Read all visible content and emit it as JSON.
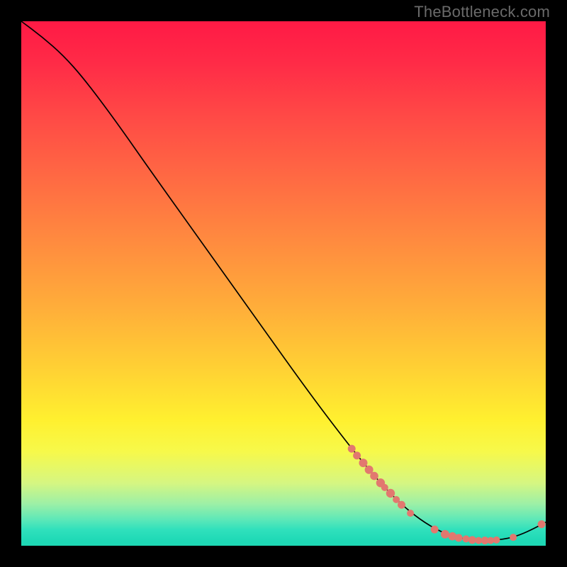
{
  "watermark": "TheBottleneck.com",
  "colors": {
    "marker": "#e2786f",
    "curve": "#000000",
    "frame_bg": "#000000"
  },
  "chart_data": {
    "type": "line",
    "title": "",
    "xlabel": "",
    "ylabel": "",
    "x_range": [
      0,
      100
    ],
    "y_range": [
      0,
      100
    ],
    "curve": [
      {
        "x": 0,
        "y": 100
      },
      {
        "x": 4,
        "y": 97
      },
      {
        "x": 8,
        "y": 93.5
      },
      {
        "x": 12,
        "y": 89
      },
      {
        "x": 18,
        "y": 81
      },
      {
        "x": 25,
        "y": 71
      },
      {
        "x": 35,
        "y": 57
      },
      {
        "x": 45,
        "y": 43
      },
      {
        "x": 55,
        "y": 29
      },
      {
        "x": 63,
        "y": 18.5
      },
      {
        "x": 68,
        "y": 12.5
      },
      {
        "x": 72,
        "y": 8.3
      },
      {
        "x": 76,
        "y": 5.0
      },
      {
        "x": 80,
        "y": 2.6
      },
      {
        "x": 84,
        "y": 1.3
      },
      {
        "x": 88,
        "y": 1.0
      },
      {
        "x": 92,
        "y": 1.2
      },
      {
        "x": 95,
        "y": 2.0
      },
      {
        "x": 98,
        "y": 3.4
      },
      {
        "x": 100,
        "y": 4.5
      }
    ],
    "markers": [
      {
        "x": 63.0,
        "y": 18.5,
        "r": 5.5
      },
      {
        "x": 64.0,
        "y": 17.2,
        "r": 5.5
      },
      {
        "x": 65.2,
        "y": 15.8,
        "r": 6.0
      },
      {
        "x": 66.3,
        "y": 14.5,
        "r": 6.0
      },
      {
        "x": 67.3,
        "y": 13.3,
        "r": 5.8
      },
      {
        "x": 68.5,
        "y": 12.0,
        "r": 6.2
      },
      {
        "x": 69.3,
        "y": 11.1,
        "r": 5.0
      },
      {
        "x": 70.4,
        "y": 10.0,
        "r": 6.2
      },
      {
        "x": 71.5,
        "y": 8.8,
        "r": 5.0
      },
      {
        "x": 72.5,
        "y": 7.8,
        "r": 5.5
      },
      {
        "x": 74.2,
        "y": 6.2,
        "r": 5.0
      },
      {
        "x": 78.8,
        "y": 3.1,
        "r": 5.5
      },
      {
        "x": 80.8,
        "y": 2.2,
        "r": 6.0
      },
      {
        "x": 82.2,
        "y": 1.8,
        "r": 5.8
      },
      {
        "x": 83.4,
        "y": 1.5,
        "r": 5.5
      },
      {
        "x": 84.8,
        "y": 1.3,
        "r": 5.0
      },
      {
        "x": 86.0,
        "y": 1.1,
        "r": 5.5
      },
      {
        "x": 87.2,
        "y": 1.0,
        "r": 5.0
      },
      {
        "x": 88.4,
        "y": 1.0,
        "r": 5.5
      },
      {
        "x": 89.5,
        "y": 1.0,
        "r": 5.0
      },
      {
        "x": 90.6,
        "y": 1.1,
        "r": 5.0
      },
      {
        "x": 93.8,
        "y": 1.6,
        "r": 5.0
      },
      {
        "x": 99.2,
        "y": 4.1,
        "r": 5.5
      }
    ]
  }
}
